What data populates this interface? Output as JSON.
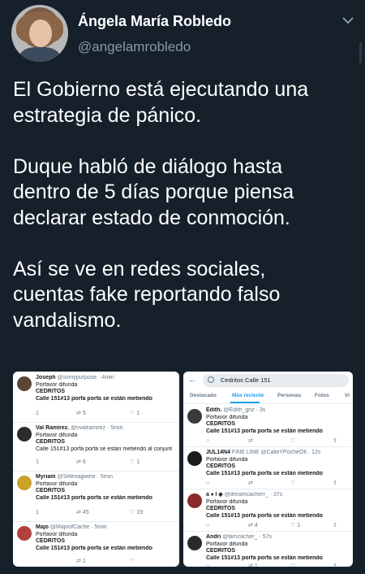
{
  "author": {
    "name": "Ángela María Robledo",
    "handle": "@angelamrobledo"
  },
  "tweet": {
    "text": "El Gobierno está ejecutando una\nestrategia de pánico.\n\nDuque habló de diálogo hasta\ndentro de 5 días porque piensa\ndeclarar estado de conmoción.\n\nAsí se ve en redes sociales,\ncuentas fake reportando falso\nvandalismo."
  },
  "left_screenshot": {
    "tweets": [
      {
        "name": "Joseph",
        "handle": "@svmypurpose · 4min",
        "l1": "Porfavor difunda",
        "l2": "CEDRITOS",
        "l3": "Calle 151#13 porfa porfa se están metiendo",
        "reply": "1",
        "rt": "5",
        "like": "1"
      },
      {
        "name": "Val Ramírez.",
        "handle": "@vvalramirez · 5min",
        "l1": "Porfavor difunda",
        "l2": "CEDRITOS",
        "l3": "Calle 151#13 porfa porfa se están metiendo al conjunt",
        "reply": "1",
        "rt": "6",
        "like": "1"
      },
      {
        "name": "Myriam",
        "handle": "@Selenagwine · 5min",
        "l1": "Porfavor difunda",
        "l2": "CEDRITOS",
        "l3": "Calle 151#13 porfa porfa se están metiendo",
        "reply": "1",
        "rt": "45",
        "like": "19"
      },
      {
        "name": "Majo",
        "handle": "@MajoofCache · 5min",
        "l1": "Porfavor difunda",
        "l2": "CEDRITOS",
        "l3": "Calle 151#13 porfa porfa se están metiendo",
        "reply": "",
        "rt": "1",
        "like": ""
      }
    ]
  },
  "right_screenshot": {
    "search_query": "Cedritos Calle 151",
    "tabs": [
      "Destacado",
      "Más reciente",
      "Personas",
      "Fotos",
      "Vi"
    ],
    "tweets": [
      {
        "name": "Edith.",
        "handle": "@Edith_gnz · 3s",
        "l1": "Porfavor difunda",
        "l2": "CEDRITOS",
        "l3": "Calle 151#13 porfa porfa se están metiendo",
        "rt": "",
        "like": ""
      },
      {
        "name": "JUL14N4",
        "handle": "FINE LINE @CalleYPocheOfi · 12s",
        "l1": "Porfavor difunda",
        "l2": "CEDRITOS",
        "l3": "Calle 151#13 porfa porfa se están metiendo",
        "rt": "",
        "like": ""
      },
      {
        "name": "a ♦ l ◈",
        "handle": "@dreamcacherr_ · 37s",
        "l1": "Porfavor difunda",
        "l2": "CEDRITOS",
        "l3": "Calle 151#13 porfa porfa se están metiendo",
        "rt": "4",
        "like": "1"
      },
      {
        "name": "Andri",
        "handle": "@lamcacher_ · 57s",
        "l1": "Porfavor difunda",
        "l2": "CEDRITOS",
        "l3": "Calle 151#13 porfa porfa se están metiendo",
        "rt": "1",
        "like": ""
      }
    ]
  }
}
